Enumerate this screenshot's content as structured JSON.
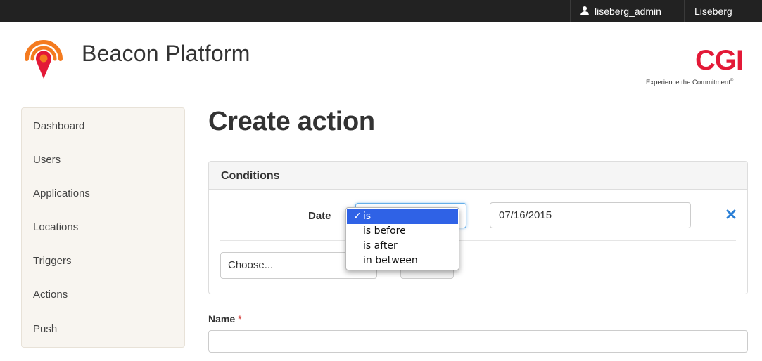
{
  "topbar": {
    "username": "liseberg_admin",
    "organization": "Liseberg"
  },
  "header": {
    "brand_title": "Beacon Platform",
    "partner_logo": "CGI",
    "partner_tagline": "Experience the Commitment",
    "partner_tagline_mark": "©"
  },
  "sidebar": {
    "items": [
      {
        "label": "Dashboard"
      },
      {
        "label": "Users"
      },
      {
        "label": "Applications"
      },
      {
        "label": "Locations"
      },
      {
        "label": "Triggers"
      },
      {
        "label": "Actions"
      },
      {
        "label": "Push"
      }
    ]
  },
  "main": {
    "title": "Create action",
    "conditions": {
      "heading": "Conditions",
      "rows": [
        {
          "label": "Date",
          "operator_selected": "is",
          "operator_options": [
            "is",
            "is before",
            "is after",
            "in between"
          ],
          "value": "07/16/2015"
        }
      ],
      "add_condition_select": "Choose..."
    },
    "name_field": {
      "label": "Name",
      "required_mark": "*",
      "value": ""
    }
  },
  "colors": {
    "topbar_bg": "#222222",
    "accent_orange": "#f47b20",
    "accent_red": "#e31937",
    "remove_blue": "#2a7fd6",
    "dropdown_highlight": "#2f62e6"
  },
  "icons": {
    "user": "user-icon",
    "logo": "beacon-logo-icon",
    "remove": "remove-x-icon",
    "check": "checkmark-icon"
  }
}
